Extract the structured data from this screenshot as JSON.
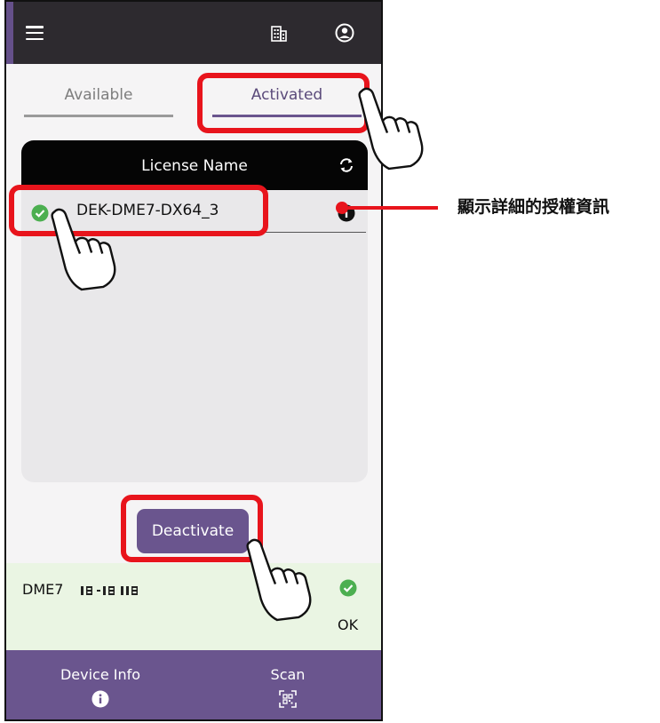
{
  "app_bar": {
    "menu_icon": "hamburger-menu-icon",
    "building_icon": "building-icon",
    "account_icon": "account-circle-icon"
  },
  "tabs": [
    {
      "label": "Available",
      "selected": false
    },
    {
      "label": "Activated",
      "selected": true
    }
  ],
  "license_table": {
    "header": "License Name",
    "refresh_icon": "refresh-icon",
    "rows": [
      {
        "name": "DEK-DME7-DX64_3",
        "status_icon": "check-circle-icon",
        "info_icon": "info-icon"
      }
    ]
  },
  "deactivate_label": "Deactivate",
  "device_status": {
    "model": "DME7",
    "status": "OK",
    "status_icon": "check-circle-icon"
  },
  "bottom_nav": [
    {
      "label": "Device Info",
      "icon": "info-icon"
    },
    {
      "label": "Scan",
      "icon": "qr-scan-icon"
    }
  ],
  "annotation": {
    "text": "顯示詳細的授權資訊"
  },
  "colors": {
    "accent": "#6a558e",
    "app_bar": "#2d2a2f",
    "callout": "#e8141c",
    "success": "#4caf50",
    "status_bg": "#eaf5e3"
  }
}
